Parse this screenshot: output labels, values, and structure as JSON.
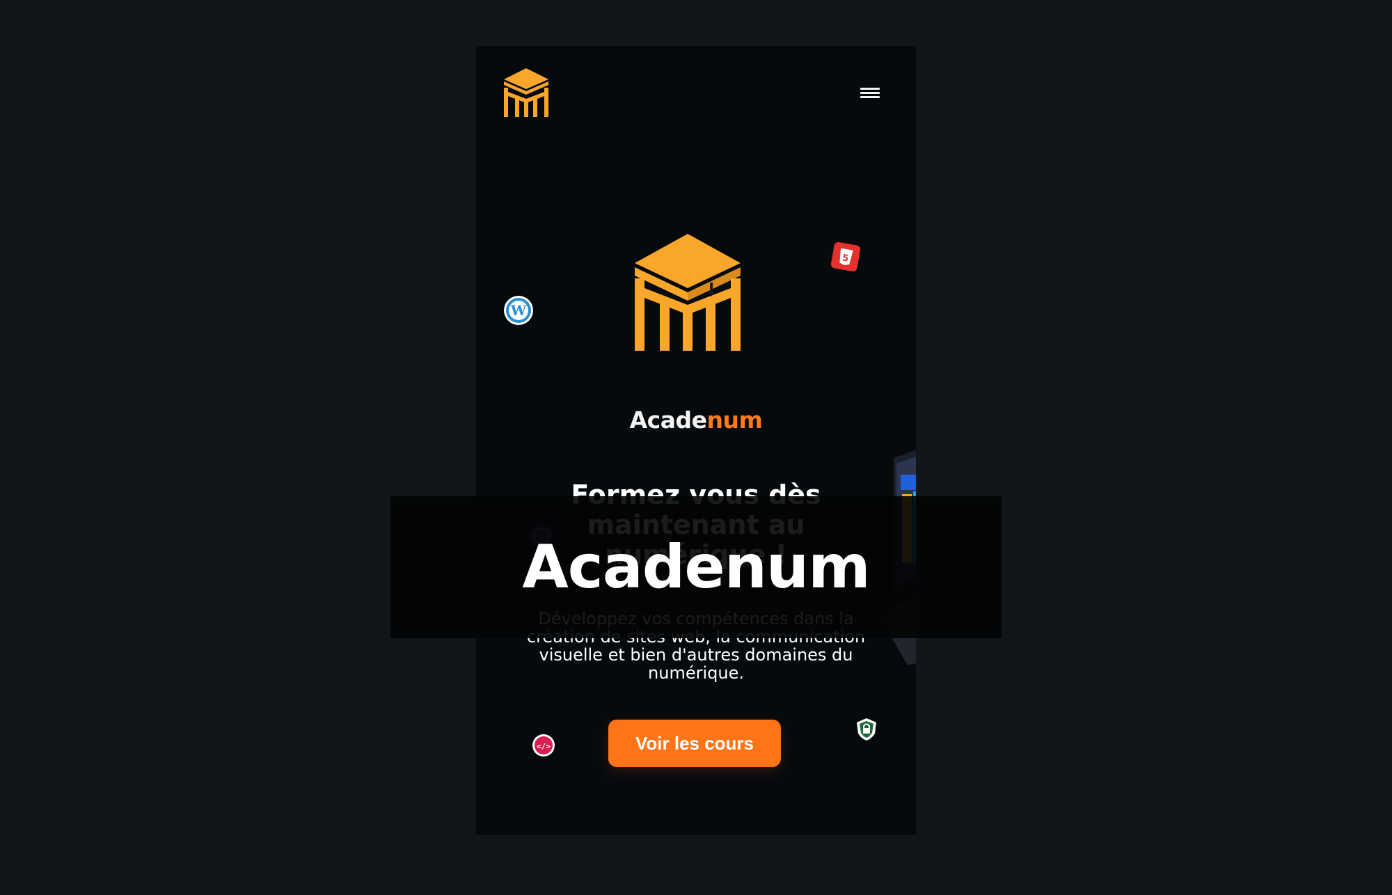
{
  "brand": {
    "name_white": "Acade",
    "name_orange": "num"
  },
  "hero": {
    "headline": "Formez vous dès maintenant au numérique !",
    "subtitle": "Développez vos compétences dans la création de sites web, la communication visuelle et bien d'autres domaines du numérique.",
    "cta_label": "Voir les cours"
  },
  "overlay": {
    "title": "Acadenum"
  },
  "icons": [
    "logo-icon",
    "menu-icon",
    "wordpress-icon",
    "html5-icon",
    "code-icon",
    "lock-shield-icon",
    "laptop-illustration"
  ],
  "colors": {
    "background": "#11161b",
    "phone_background": "#070a0d",
    "logo_yellow": "#f9a72b",
    "accent_orange": "#ff7417",
    "html5_red": "#e5322d",
    "wordpress_blue": "#2a8fd0"
  }
}
